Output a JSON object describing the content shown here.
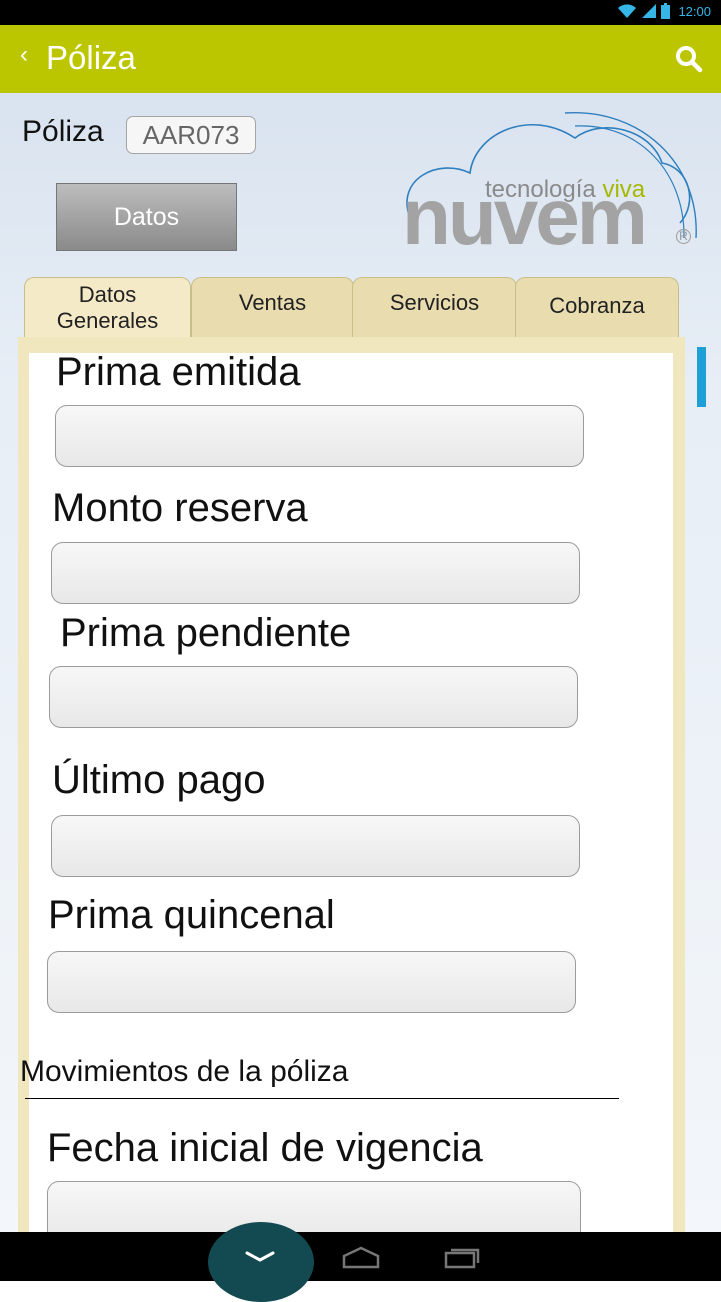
{
  "status_bar": {
    "time": "12:00"
  },
  "action_bar": {
    "back_glyph": "‹",
    "title": "Póliza",
    "search_icon": "search-icon"
  },
  "header": {
    "poliza_label": "Póliza",
    "poliza_value": "AAR073",
    "datos_button": "Datos"
  },
  "logo": {
    "tagline_start": "tecnología",
    "tagline_accent": "viva",
    "wordmark": "nuvem",
    "registered": "R"
  },
  "tabs": [
    {
      "line1": "Datos",
      "line2": "Generales",
      "active": true
    },
    {
      "line1": "Ventas",
      "line2": ""
    },
    {
      "line1": "Servicios",
      "line2": ""
    },
    {
      "line1": "Cobranza",
      "line2": ""
    }
  ],
  "form": {
    "fields": [
      {
        "label": "Prima emitida",
        "value": ""
      },
      {
        "label": "Monto reserva",
        "value": ""
      },
      {
        "label": "Prima pendiente",
        "value": ""
      },
      {
        "label": "Último pago",
        "value": ""
      },
      {
        "label": "Prima quincenal",
        "value": ""
      }
    ],
    "section_title": "Movimientos de la póliza",
    "section_fields": [
      {
        "label": "Fecha inicial de vigencia",
        "value": ""
      }
    ]
  },
  "colors": {
    "action_bar": "#bcc600",
    "accent_blue": "#1e9fd6",
    "tab_bg": "#e9ddb0",
    "logo_green": "#a6b800"
  },
  "nav_bar": {
    "icons": [
      "chevron-down-icon",
      "home-icon",
      "recent-apps-icon"
    ]
  }
}
